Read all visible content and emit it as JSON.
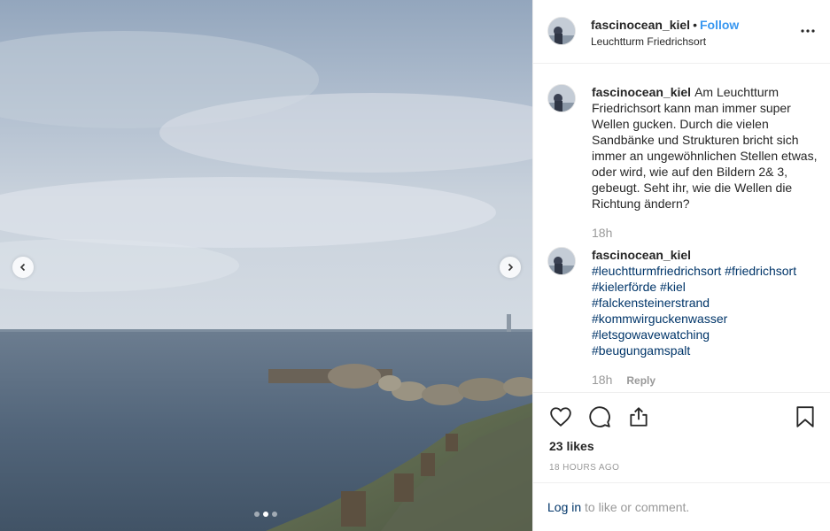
{
  "post": {
    "username": "fascinocean_kiel",
    "separator": "•",
    "follow_label": "Follow",
    "location": "Leuchtturm Friedrichsort"
  },
  "comments": [
    {
      "username": "fascinocean_kiel",
      "text": "Am Leuchtturm Friedrichsort kann man immer super Wellen gucken. Durch die vielen Sandbänke und Strukturen bricht sich immer an ungewöhnlichen Stellen etwas, oder wird, wie auf den Bildern 2& 3, gebeugt. Seht ihr, wie die Wellen die Richtung ändern?",
      "time": "18h"
    },
    {
      "username": "fascinocean_kiel",
      "hashtags": [
        "#leuchtturmfriedrichsort #friedrichsort",
        "#kielerförde #kiel",
        "#falckensteinerstrand",
        "#kommwirguckenwasser",
        "#letsgowavewatching",
        "#beugungamspalt"
      ],
      "time": "18h",
      "reply_label": "Reply"
    }
  ],
  "likes": "23 likes",
  "time_ago": "18 hours ago",
  "login": {
    "link": "Log in",
    "rest": " to like or comment."
  },
  "carousel": {
    "slide_count": 3,
    "active_slide": 2
  },
  "icons": {
    "like": "heart-icon",
    "comment": "comment-icon",
    "share": "share-icon",
    "save": "bookmark-icon",
    "more": "more-options-icon"
  },
  "colors": {
    "follow": "#3897f0",
    "link": "#003569",
    "muted": "#999999"
  }
}
